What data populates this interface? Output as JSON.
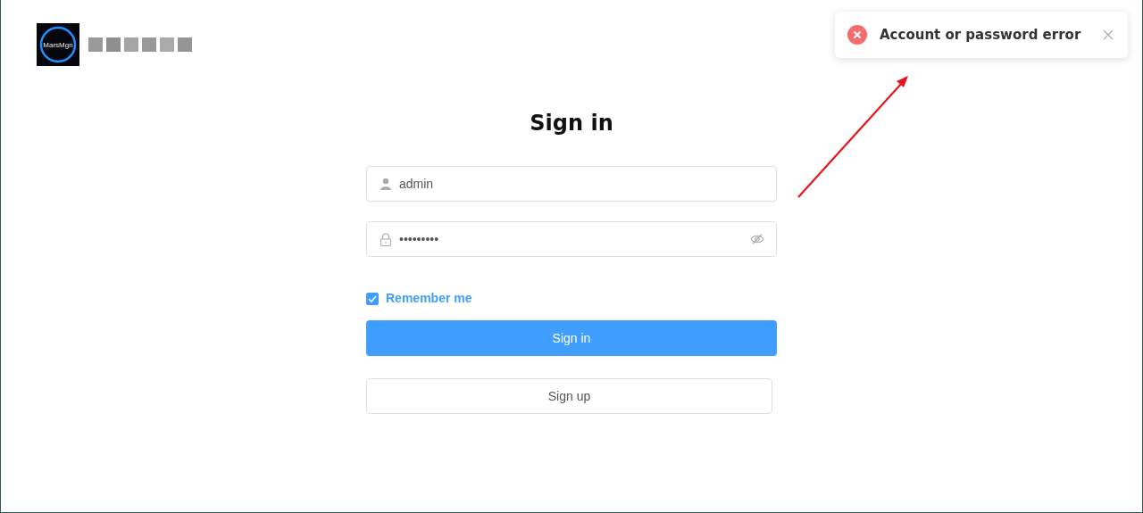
{
  "logo": {
    "text": "MarsMgn"
  },
  "toast": {
    "kind": "error",
    "message": "Account or password error"
  },
  "title": "Sign in",
  "username": {
    "value": "admin"
  },
  "password": {
    "value": "•••••••••"
  },
  "remember": {
    "label": "Remember me",
    "checked": true
  },
  "sign_in_button": "Sign in",
  "sign_up_button": "Sign up"
}
